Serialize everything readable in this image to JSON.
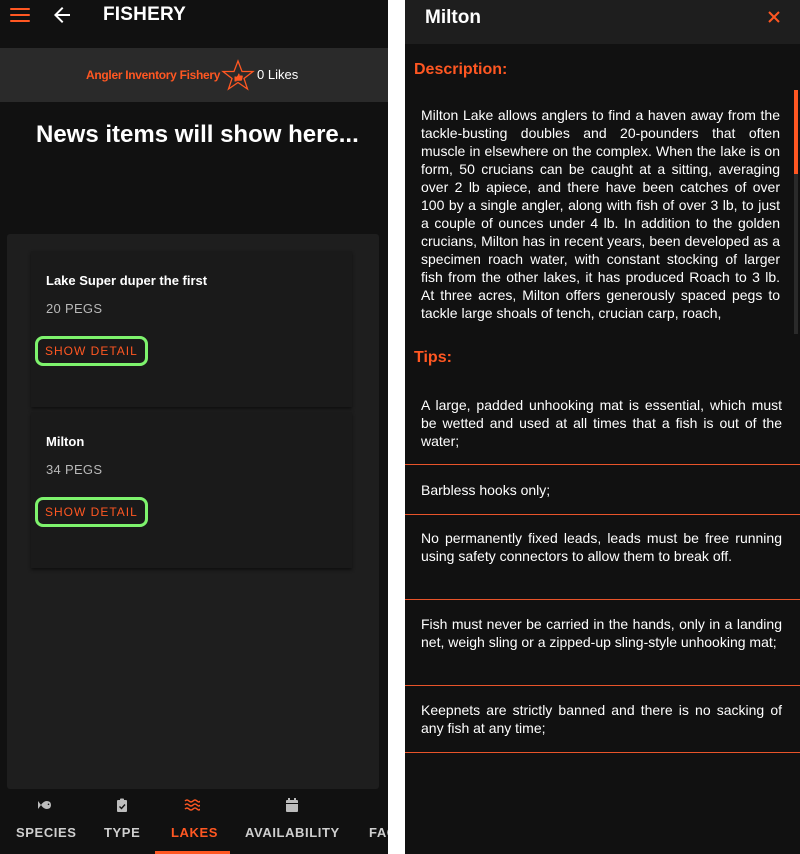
{
  "appbar": {
    "title": "FISHERY"
  },
  "banner": {
    "fishery_name": "Angler Inventory Fishery",
    "likes": "0 Likes"
  },
  "news": {
    "placeholder": "News items will show here..."
  },
  "lakes": [
    {
      "name": "Lake Super duper the first",
      "pegs": "20 PEGS",
      "button": "SHOW DETAIL"
    },
    {
      "name": "Milton",
      "pegs": "34 PEGS",
      "button": "SHOW DETAIL"
    }
  ],
  "bottom_nav": [
    {
      "label": "SPECIES",
      "icon": "fish-icon",
      "active": false
    },
    {
      "label": "TYPE",
      "icon": "clipboard-icon",
      "active": false
    },
    {
      "label": "LAKES",
      "icon": "waves-icon",
      "active": true
    },
    {
      "label": "AVAILABILITY",
      "icon": "calendar-icon",
      "active": false
    },
    {
      "label": "FAC",
      "icon": "",
      "active": false
    }
  ],
  "dialog": {
    "title": "Milton",
    "close_icon": "close-icon",
    "description_heading": "Description:",
    "description": "Milton Lake allows anglers to find a haven away from the tackle-busting doubles and 20-pounders that often muscle in elsewhere on the complex. When the lake is on form, 50 crucians can be caught at a sitting, averaging over 2 lb apiece, and there have been catches of over 100 by a single angler, along with fish of over 3 lb, to just a couple of ounces under 4 lb. In addition to the golden crucians, Milton has in recent years, been developed as a specimen roach water, with constant stocking of larger fish from the other lakes, it has produced Roach to 3 lb. At three acres, Milton offers generously spaced pegs to tackle large shoals of tench, crucian carp, roach,",
    "tips_heading": "Tips:",
    "tips": [
      "A large, padded unhooking mat is essential, which must be wetted and used at all times that a fish is out of the water;",
      "Barbless hooks only;",
      "No permanently fixed leads, leads must be free running using safety connectors to allow them to break off.",
      "Fish must never be carried in the hands, only in a landing net, weigh sling or a zipped-up sling-style unhooking mat;",
      "Keepnets are strictly banned and there is no sacking of any fish at any time;"
    ]
  },
  "colors": {
    "accent": "#ff5722",
    "highlight": "#7ef36d",
    "background": "#111111"
  }
}
